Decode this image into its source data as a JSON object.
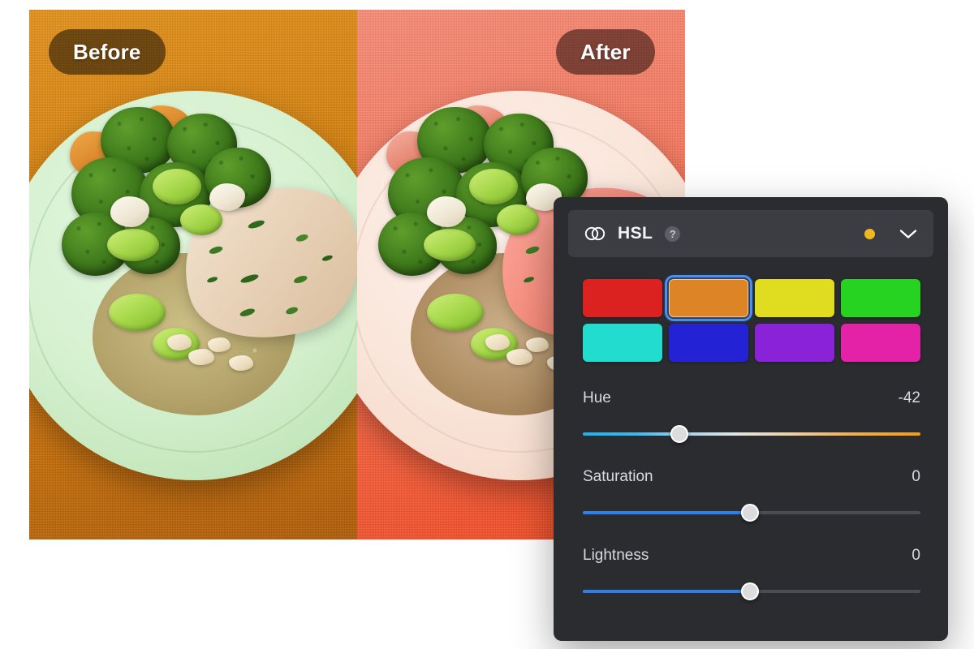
{
  "comparison": {
    "before_label": "Before",
    "after_label": "After"
  },
  "panel": {
    "title": "HSL",
    "icon": "overlapping-circles-icon",
    "help_icon": "?",
    "status_dot_color": "#f3b520",
    "collapse_icon": "chevron-down-icon",
    "swatches": [
      {
        "name": "red",
        "color": "#dc2121",
        "selected": false
      },
      {
        "name": "orange",
        "color": "#dd8526",
        "selected": true
      },
      {
        "name": "yellow",
        "color": "#e0dd21",
        "selected": false
      },
      {
        "name": "green",
        "color": "#27d321",
        "selected": false
      },
      {
        "name": "cyan",
        "color": "#23dcd0",
        "selected": false
      },
      {
        "name": "blue",
        "color": "#2323d5",
        "selected": false
      },
      {
        "name": "purple",
        "color": "#8a22d8",
        "selected": false
      },
      {
        "name": "magenta",
        "color": "#e322a8",
        "selected": false
      }
    ],
    "sliders": [
      {
        "name": "hue",
        "label": "Hue",
        "value": "-42",
        "position_pct": 28.5
      },
      {
        "name": "saturation",
        "label": "Saturation",
        "value": "0",
        "position_pct": 49.5
      },
      {
        "name": "lightness",
        "label": "Lightness",
        "value": "0",
        "position_pct": 49.5
      }
    ]
  }
}
